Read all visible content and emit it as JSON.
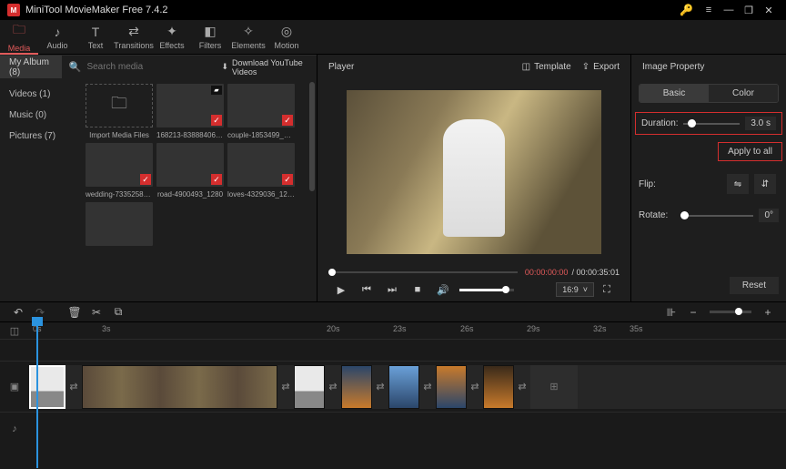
{
  "app": {
    "title": "MiniTool MovieMaker Free 7.4.2",
    "logo_letter": "M"
  },
  "toolbar": [
    {
      "label": "Media",
      "icon": "🗀",
      "active": true
    },
    {
      "label": "Audio",
      "icon": "♪",
      "active": false
    },
    {
      "label": "Text",
      "icon": "T",
      "active": false
    },
    {
      "label": "Transitions",
      "icon": "⇄",
      "active": false
    },
    {
      "label": "Effects",
      "icon": "✦",
      "active": false
    },
    {
      "label": "Filters",
      "icon": "◧",
      "active": false
    },
    {
      "label": "Elements",
      "icon": "✧",
      "active": false
    },
    {
      "label": "Motion",
      "icon": "◎",
      "active": false
    }
  ],
  "media": {
    "album": "My Album (8)",
    "search_placeholder": "Search media",
    "download_label": "Download YouTube Videos",
    "side_items": [
      {
        "label": "Videos (1)"
      },
      {
        "label": "Music (0)"
      },
      {
        "label": "Pictures (7)"
      }
    ],
    "thumbs": [
      {
        "label": "Import Media Files",
        "import": true
      },
      {
        "label": "168213-838884062...",
        "fill": "fill-b",
        "checked": true,
        "video": true
      },
      {
        "label": "couple-1853499_12...",
        "fill": "fill-c",
        "checked": true
      },
      {
        "label": "wedding-7335258_...",
        "fill": "fill-d",
        "checked": true
      },
      {
        "label": "road-4900493_1280",
        "fill": "fill-e",
        "checked": true
      },
      {
        "label": "loves-4329036_1280",
        "fill": "fill-f",
        "checked": true
      },
      {
        "label": "",
        "fill": "fill-a"
      }
    ]
  },
  "player": {
    "title": "Player",
    "template": "Template",
    "export": "Export",
    "time_current": "00:00:00:00",
    "time_total": "00:00:35:01",
    "ratio": "16:9"
  },
  "prop": {
    "title": "Image Property",
    "tab_basic": "Basic",
    "tab_color": "Color",
    "duration_label": "Duration:",
    "duration_value": "3.0 s",
    "apply_all": "Apply to all",
    "flip_label": "Flip:",
    "rotate_label": "Rotate:",
    "rotate_value": "0°",
    "reset": "Reset"
  },
  "ruler": {
    "t0": "0s",
    "t1": "3s",
    "t2": "20s",
    "t3": "23s",
    "t4": "26s",
    "t5": "29s",
    "t6": "32s",
    "t7": "35s"
  }
}
